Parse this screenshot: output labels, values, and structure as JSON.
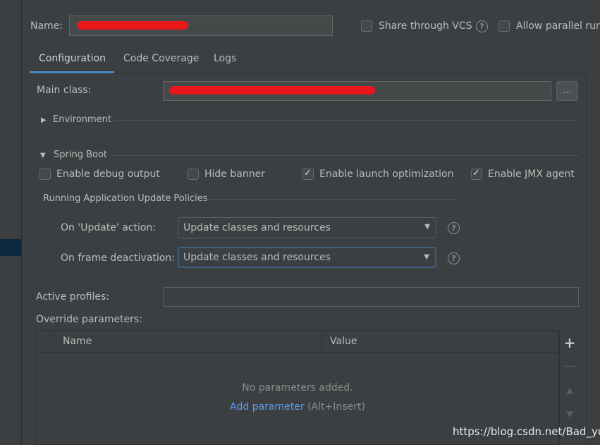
{
  "header": {
    "name_label": "Name:",
    "name_value": "",
    "share_vcs_label": "Share through VCS",
    "share_vcs_checked": false,
    "allow_parallel_label": "Allow parallel run",
    "allow_parallel_checked": false
  },
  "tabs": [
    {
      "label": "Configuration",
      "active": true
    },
    {
      "label": "Code Coverage",
      "active": false
    },
    {
      "label": "Logs",
      "active": false
    }
  ],
  "main_class": {
    "label": "Main class:",
    "value": "",
    "browse_label": "..."
  },
  "environment": {
    "title": "Environment"
  },
  "spring_boot": {
    "title": "Spring Boot",
    "options": [
      {
        "label": "Enable debug output",
        "checked": false
      },
      {
        "label": "Hide banner",
        "checked": false
      },
      {
        "label": "Enable launch optimization",
        "checked": true
      },
      {
        "label": "Enable JMX agent",
        "checked": true
      }
    ],
    "policies_title": "Running Application Update Policies",
    "on_update": {
      "label": "On 'Update' action:",
      "value": "Update classes and resources"
    },
    "on_frame": {
      "label": "On frame deactivation:",
      "value": "Update classes and resources"
    }
  },
  "active_profiles": {
    "label": "Active profiles:",
    "value": ""
  },
  "override": {
    "label": "Override parameters:",
    "columns": [
      "Name",
      "Value"
    ],
    "empty_text": "No parameters added.",
    "add_link": "Add parameter",
    "add_shortcut": " (Alt+Insert)"
  },
  "icons": {
    "help": "question-circle-icon",
    "expand": "triangle-right-icon",
    "collapse": "triangle-down-icon",
    "dropdown": "chevron-down-icon",
    "add": "plus-icon",
    "remove": "minus-icon",
    "up": "arrow-up-icon",
    "down": "arrow-down-icon"
  },
  "colors": {
    "background": "#3c3f41",
    "accent": "#4a88c7",
    "link": "#589df6",
    "redaction": "#e8181b"
  },
  "watermark": "https://blog.csdn.net/Bad_yu"
}
